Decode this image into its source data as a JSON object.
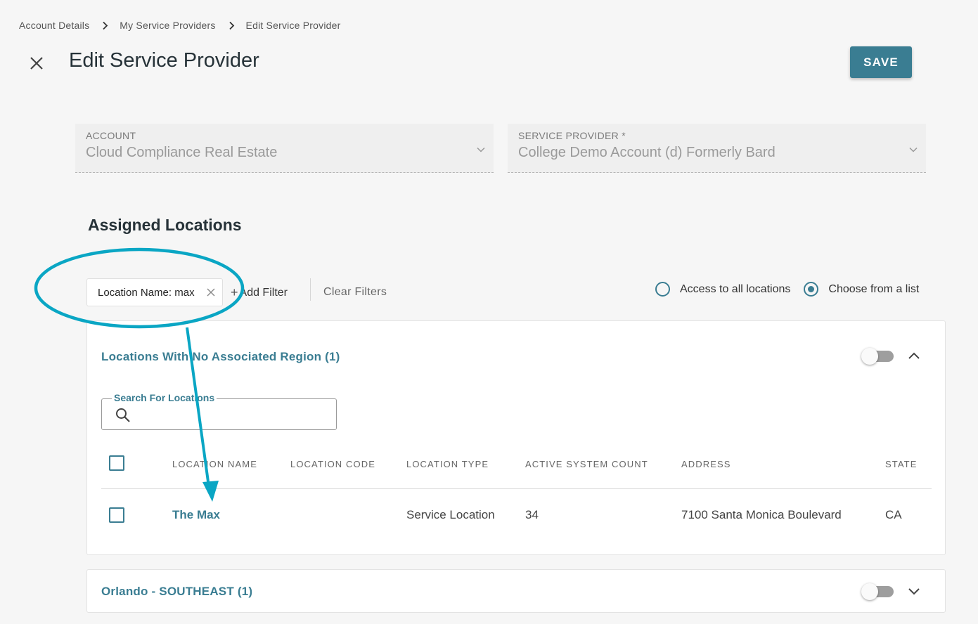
{
  "breadcrumb": {
    "items": [
      "Account Details",
      "My Service Providers",
      "Edit Service Provider"
    ]
  },
  "header": {
    "title": "Edit Service Provider",
    "save_label": "SAVE"
  },
  "form": {
    "account": {
      "label": "ACCOUNT",
      "value": "Cloud Compliance Real Estate"
    },
    "service_provider": {
      "label": "SERVICE PROVIDER *",
      "value": "College Demo Account (d) Formerly Bard"
    }
  },
  "assigned_locations": {
    "title": "Assigned Locations",
    "filter_chip": "Location Name: max",
    "add_filter_plus": "+",
    "add_filter": "Add Filter",
    "clear_filters": "Clear Filters",
    "radio_options": [
      {
        "label": "Access to all locations",
        "checked": false
      },
      {
        "label": "Choose from a list",
        "checked": true
      }
    ]
  },
  "groups": [
    {
      "title": "Locations With No Associated Region (1)",
      "expanded": true,
      "search": {
        "label": "Search For Locations",
        "value": "",
        "placeholder": ""
      },
      "columns": [
        "LOCATION NAME",
        "LOCATION CODE",
        "LOCATION TYPE",
        "ACTIVE SYSTEM COUNT",
        "ADDRESS",
        "STATE"
      ],
      "rows": [
        {
          "location_name": "The Max",
          "location_code": "",
          "location_type": "Service Location",
          "active_system_count": "34",
          "address": "7100 Santa Monica Boulevard",
          "state": "CA"
        }
      ]
    },
    {
      "title": "Orlando - SOUTHEAST (1)",
      "expanded": false
    }
  ],
  "colors": {
    "accent": "#3a7d92",
    "annotation": "#0aa6c4",
    "background": "#f6f6f6"
  },
  "icons": [
    "chevron-right-icon",
    "close-icon",
    "chevron-down-icon",
    "chevron-up-icon",
    "search-icon",
    "checkbox-icon"
  ]
}
